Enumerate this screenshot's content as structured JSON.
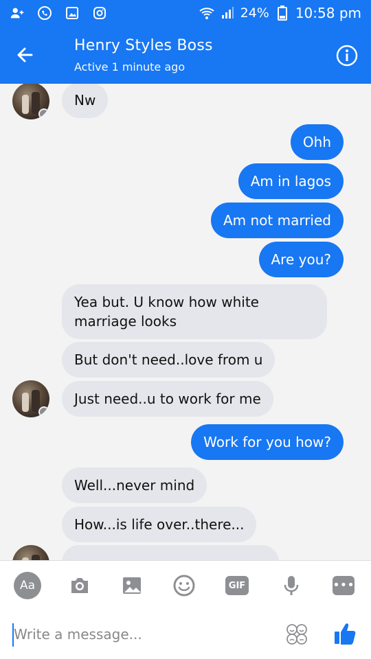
{
  "status": {
    "battery": "24%",
    "time": "10:58 pm"
  },
  "header": {
    "title": "Henry Styles Boss",
    "subtitle": "Active 1 minute ago"
  },
  "messages": [
    {
      "side": "in",
      "text": "Nw"
    },
    {
      "side": "out",
      "text": "Ohh"
    },
    {
      "side": "out",
      "text": "Am in lagos"
    },
    {
      "side": "out",
      "text": "Am not married"
    },
    {
      "side": "out",
      "text": "Are you?"
    },
    {
      "side": "in",
      "text": "Yea but. U know how white marriage looks"
    },
    {
      "side": "in",
      "text": "But don't need..love from u"
    },
    {
      "side": "in",
      "text": "Just need..u to work for me"
    },
    {
      "side": "out",
      "text": "Work for you how?"
    },
    {
      "side": "in",
      "text": "Well...never mind"
    },
    {
      "side": "in",
      "text": "How...is life over..there..."
    }
  ],
  "toolbar": {
    "aa_label": "Aa",
    "gif_label": "GIF",
    "more_label": "•••"
  },
  "composer": {
    "placeholder": "Write a message..."
  },
  "colors": {
    "brand": "#1877f2",
    "incoming": "#e4e6eb"
  }
}
